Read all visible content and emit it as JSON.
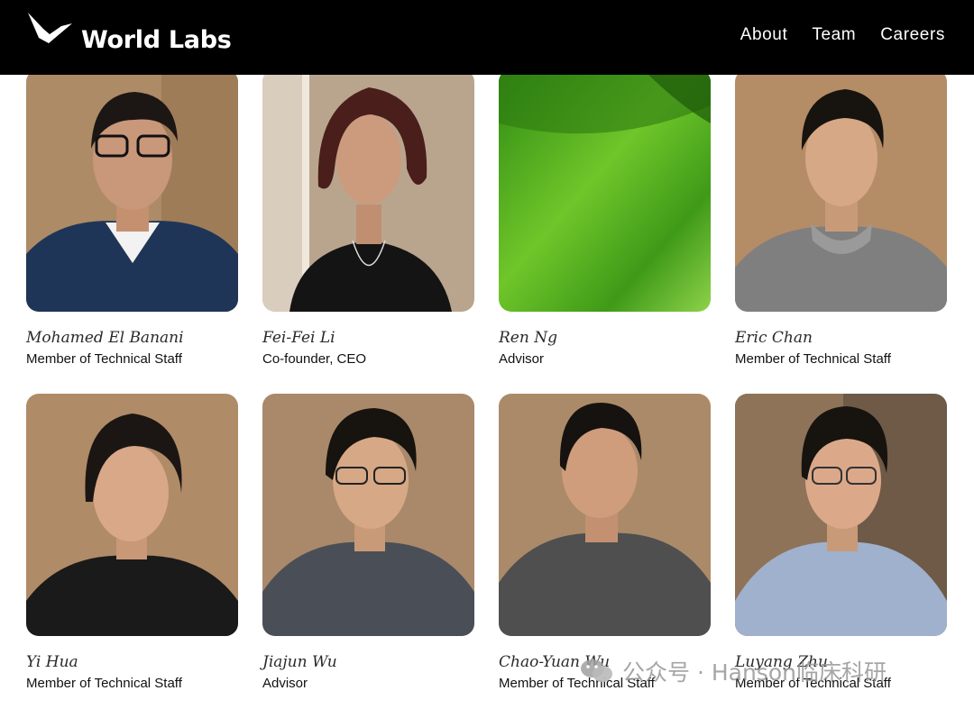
{
  "header": {
    "brand": "World Labs",
    "nav": [
      "About",
      "Team",
      "Careers"
    ]
  },
  "team": [
    {
      "name": "Mohamed El Banani",
      "role": "Member of Technical Staff"
    },
    {
      "name": "Fei-Fei Li",
      "role": "Co-founder, CEO"
    },
    {
      "name": "Ren Ng",
      "role": "Advisor"
    },
    {
      "name": "Eric Chan",
      "role": "Member of Technical Staff"
    },
    {
      "name": "Yi Hua",
      "role": "Member of Technical Staff"
    },
    {
      "name": "Jiajun Wu",
      "role": "Advisor"
    },
    {
      "name": "Chao-Yuan Wu",
      "role": "Member of Technical Staff"
    },
    {
      "name": "Luyang Zhu",
      "role": "Member of Technical Staff"
    }
  ],
  "watermark": {
    "text": "公众号 · Hanson临床科研",
    "icon": "wechat-icon"
  },
  "colors": {
    "header_bg": "#000000",
    "page_bg": "#ffffff",
    "wall": "#b08a62",
    "green": "#4caf1e"
  }
}
